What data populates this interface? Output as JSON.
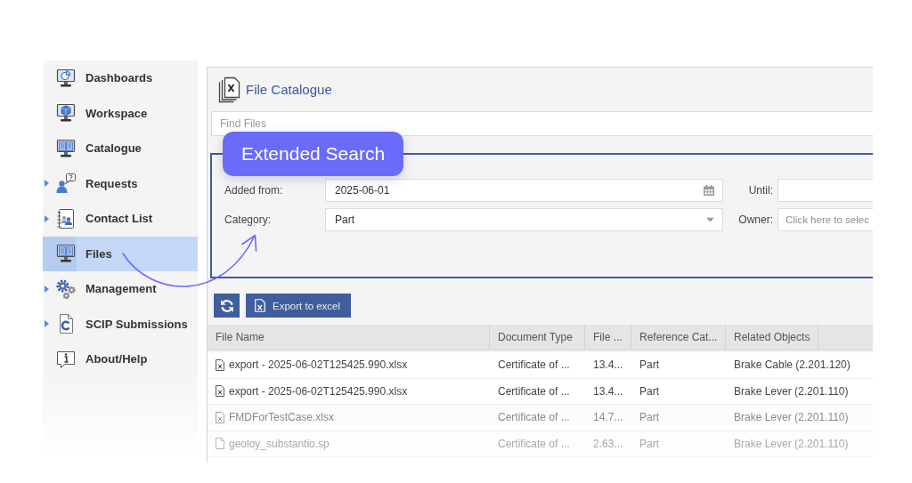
{
  "sidebar": {
    "items": [
      {
        "label": "Dashboards",
        "expandable": false,
        "selected": false
      },
      {
        "label": "Workspace",
        "expandable": false,
        "selected": false
      },
      {
        "label": "Catalogue",
        "expandable": false,
        "selected": false
      },
      {
        "label": "Requests",
        "expandable": true,
        "selected": false
      },
      {
        "label": "Contact List",
        "expandable": true,
        "selected": false
      },
      {
        "label": "Files",
        "expandable": false,
        "selected": true
      },
      {
        "label": "Management",
        "expandable": true,
        "selected": false
      },
      {
        "label": "SCIP Submissions",
        "expandable": true,
        "selected": false
      },
      {
        "label": "About/Help",
        "expandable": false,
        "selected": false
      }
    ]
  },
  "panel": {
    "title": "File Catalogue",
    "search": {
      "placeholder": "Find Files"
    },
    "extended_search": {
      "fields": [
        {
          "label": "Added from:",
          "kind": "date",
          "value": "2025-06-01"
        },
        {
          "label": "Until:",
          "kind": "text"
        },
        {
          "label": "Category:",
          "kind": "select",
          "value": "Part"
        },
        {
          "label": "Owner:",
          "kind": "text",
          "placeholder": "Click here to selec"
        }
      ]
    },
    "toolbar": {
      "buttons": [
        {
          "kind": "refresh"
        },
        {
          "kind": "export",
          "label": "Export to excel"
        }
      ]
    },
    "table": {
      "columns": [
        "File Name",
        "Document Type",
        "File ...",
        "Reference Cat...",
        "Related Objects"
      ],
      "rows": [
        {
          "kind": "excel",
          "cells": [
            "export - 2025-06-02T125425.990.xlsx",
            "Certificate of ...",
            "13.4...",
            "Part",
            "Brake Cable (2.201.120)"
          ]
        },
        {
          "kind": "excel",
          "cells": [
            "export - 2025-06-02T125425.990.xlsx",
            "Certificate of ...",
            "13.4...",
            "Part",
            "Brake Lever (2.201.110)"
          ]
        },
        {
          "kind": "excel",
          "cells": [
            "FMDForTestCase.xlsx",
            "Certificate of ...",
            "14.7...",
            "Part",
            "Brake Lever (2.201.110)"
          ]
        },
        {
          "kind": "document",
          "cells": [
            "geoloy_substantio.sp",
            "Certificate of ...",
            "2.63...",
            "Part",
            "Brake Lever (2.201.110)"
          ]
        }
      ]
    }
  },
  "annotation": {
    "callout": "Extended Search"
  }
}
